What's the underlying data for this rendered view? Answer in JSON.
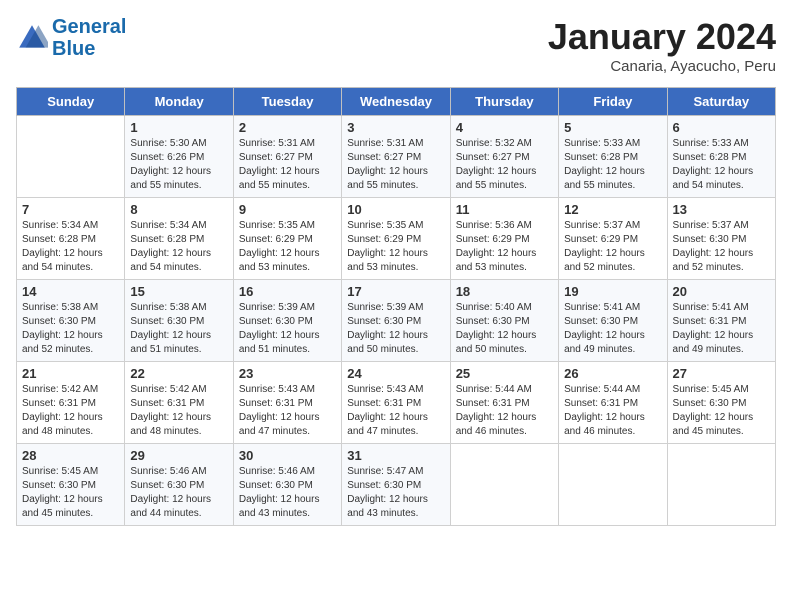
{
  "logo": {
    "line1": "General",
    "line2": "Blue"
  },
  "header": {
    "month": "January 2024",
    "location": "Canaria, Ayacucho, Peru"
  },
  "weekdays": [
    "Sunday",
    "Monday",
    "Tuesday",
    "Wednesday",
    "Thursday",
    "Friday",
    "Saturday"
  ],
  "weeks": [
    [
      {
        "day": "",
        "info": ""
      },
      {
        "day": "1",
        "info": "Sunrise: 5:30 AM\nSunset: 6:26 PM\nDaylight: 12 hours\nand 55 minutes."
      },
      {
        "day": "2",
        "info": "Sunrise: 5:31 AM\nSunset: 6:27 PM\nDaylight: 12 hours\nand 55 minutes."
      },
      {
        "day": "3",
        "info": "Sunrise: 5:31 AM\nSunset: 6:27 PM\nDaylight: 12 hours\nand 55 minutes."
      },
      {
        "day": "4",
        "info": "Sunrise: 5:32 AM\nSunset: 6:27 PM\nDaylight: 12 hours\nand 55 minutes."
      },
      {
        "day": "5",
        "info": "Sunrise: 5:33 AM\nSunset: 6:28 PM\nDaylight: 12 hours\nand 55 minutes."
      },
      {
        "day": "6",
        "info": "Sunrise: 5:33 AM\nSunset: 6:28 PM\nDaylight: 12 hours\nand 54 minutes."
      }
    ],
    [
      {
        "day": "7",
        "info": "Sunrise: 5:34 AM\nSunset: 6:28 PM\nDaylight: 12 hours\nand 54 minutes."
      },
      {
        "day": "8",
        "info": "Sunrise: 5:34 AM\nSunset: 6:28 PM\nDaylight: 12 hours\nand 54 minutes."
      },
      {
        "day": "9",
        "info": "Sunrise: 5:35 AM\nSunset: 6:29 PM\nDaylight: 12 hours\nand 53 minutes."
      },
      {
        "day": "10",
        "info": "Sunrise: 5:35 AM\nSunset: 6:29 PM\nDaylight: 12 hours\nand 53 minutes."
      },
      {
        "day": "11",
        "info": "Sunrise: 5:36 AM\nSunset: 6:29 PM\nDaylight: 12 hours\nand 53 minutes."
      },
      {
        "day": "12",
        "info": "Sunrise: 5:37 AM\nSunset: 6:29 PM\nDaylight: 12 hours\nand 52 minutes."
      },
      {
        "day": "13",
        "info": "Sunrise: 5:37 AM\nSunset: 6:30 PM\nDaylight: 12 hours\nand 52 minutes."
      }
    ],
    [
      {
        "day": "14",
        "info": "Sunrise: 5:38 AM\nSunset: 6:30 PM\nDaylight: 12 hours\nand 52 minutes."
      },
      {
        "day": "15",
        "info": "Sunrise: 5:38 AM\nSunset: 6:30 PM\nDaylight: 12 hours\nand 51 minutes."
      },
      {
        "day": "16",
        "info": "Sunrise: 5:39 AM\nSunset: 6:30 PM\nDaylight: 12 hours\nand 51 minutes."
      },
      {
        "day": "17",
        "info": "Sunrise: 5:39 AM\nSunset: 6:30 PM\nDaylight: 12 hours\nand 50 minutes."
      },
      {
        "day": "18",
        "info": "Sunrise: 5:40 AM\nSunset: 6:30 PM\nDaylight: 12 hours\nand 50 minutes."
      },
      {
        "day": "19",
        "info": "Sunrise: 5:41 AM\nSunset: 6:30 PM\nDaylight: 12 hours\nand 49 minutes."
      },
      {
        "day": "20",
        "info": "Sunrise: 5:41 AM\nSunset: 6:31 PM\nDaylight: 12 hours\nand 49 minutes."
      }
    ],
    [
      {
        "day": "21",
        "info": "Sunrise: 5:42 AM\nSunset: 6:31 PM\nDaylight: 12 hours\nand 48 minutes."
      },
      {
        "day": "22",
        "info": "Sunrise: 5:42 AM\nSunset: 6:31 PM\nDaylight: 12 hours\nand 48 minutes."
      },
      {
        "day": "23",
        "info": "Sunrise: 5:43 AM\nSunset: 6:31 PM\nDaylight: 12 hours\nand 47 minutes."
      },
      {
        "day": "24",
        "info": "Sunrise: 5:43 AM\nSunset: 6:31 PM\nDaylight: 12 hours\nand 47 minutes."
      },
      {
        "day": "25",
        "info": "Sunrise: 5:44 AM\nSunset: 6:31 PM\nDaylight: 12 hours\nand 46 minutes."
      },
      {
        "day": "26",
        "info": "Sunrise: 5:44 AM\nSunset: 6:31 PM\nDaylight: 12 hours\nand 46 minutes."
      },
      {
        "day": "27",
        "info": "Sunrise: 5:45 AM\nSunset: 6:30 PM\nDaylight: 12 hours\nand 45 minutes."
      }
    ],
    [
      {
        "day": "28",
        "info": "Sunrise: 5:45 AM\nSunset: 6:30 PM\nDaylight: 12 hours\nand 45 minutes."
      },
      {
        "day": "29",
        "info": "Sunrise: 5:46 AM\nSunset: 6:30 PM\nDaylight: 12 hours\nand 44 minutes."
      },
      {
        "day": "30",
        "info": "Sunrise: 5:46 AM\nSunset: 6:30 PM\nDaylight: 12 hours\nand 43 minutes."
      },
      {
        "day": "31",
        "info": "Sunrise: 5:47 AM\nSunset: 6:30 PM\nDaylight: 12 hours\nand 43 minutes."
      },
      {
        "day": "",
        "info": ""
      },
      {
        "day": "",
        "info": ""
      },
      {
        "day": "",
        "info": ""
      }
    ]
  ]
}
